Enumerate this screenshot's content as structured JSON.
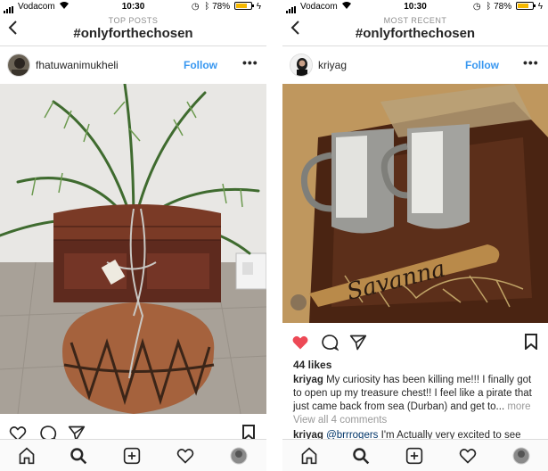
{
  "left": {
    "status": {
      "carrier": "Vodacom",
      "time": "10:30",
      "battery_text": "78%",
      "battery_level": 0.78
    },
    "header": {
      "subtitle": "TOP POSTS",
      "hashtag": "#onlyforthechosen"
    },
    "post": {
      "username": "fhatuwanimukheli",
      "follow_label": "Follow",
      "more_label": "•••"
    },
    "icons": [
      "back-chevron",
      "heart-outline",
      "comment-bubble",
      "paper-plane",
      "bookmark"
    ]
  },
  "right": {
    "status": {
      "carrier": "Vodacom",
      "time": "10:30",
      "battery_text": "78%",
      "battery_level": 0.78
    },
    "header": {
      "subtitle": "MOST RECENT",
      "hashtag": "#onlyforthechosen"
    },
    "post": {
      "username": "kriyag",
      "follow_label": "Follow",
      "more_label": "•••",
      "liked": true,
      "likes": "44 likes",
      "caption_user": "kriyag",
      "caption_text": "My curiosity has been killing me!!! I finally got to open up my treasure chest!! I feel like a pirate that just came back from sea (Durban) and get to...",
      "caption_more": "more",
      "view_comments": "View all 4 comments",
      "comment_user": "kriyag",
      "comment_mention": "@brrrogers",
      "comment_text": "I'm Actually very excited to see",
      "photo_text": "Savanna"
    },
    "icons": [
      "back-chevron",
      "heart-filled",
      "comment-bubble",
      "paper-plane",
      "bookmark"
    ]
  },
  "colors": {
    "accent": "#3897f0",
    "like": "#ed4956",
    "text": "#262626",
    "muted": "#8e8e8e",
    "battery": "#f5b800"
  },
  "tabbar": [
    "home-icon",
    "search-icon",
    "add-post-icon",
    "activity-heart-icon",
    "profile-avatar"
  ]
}
